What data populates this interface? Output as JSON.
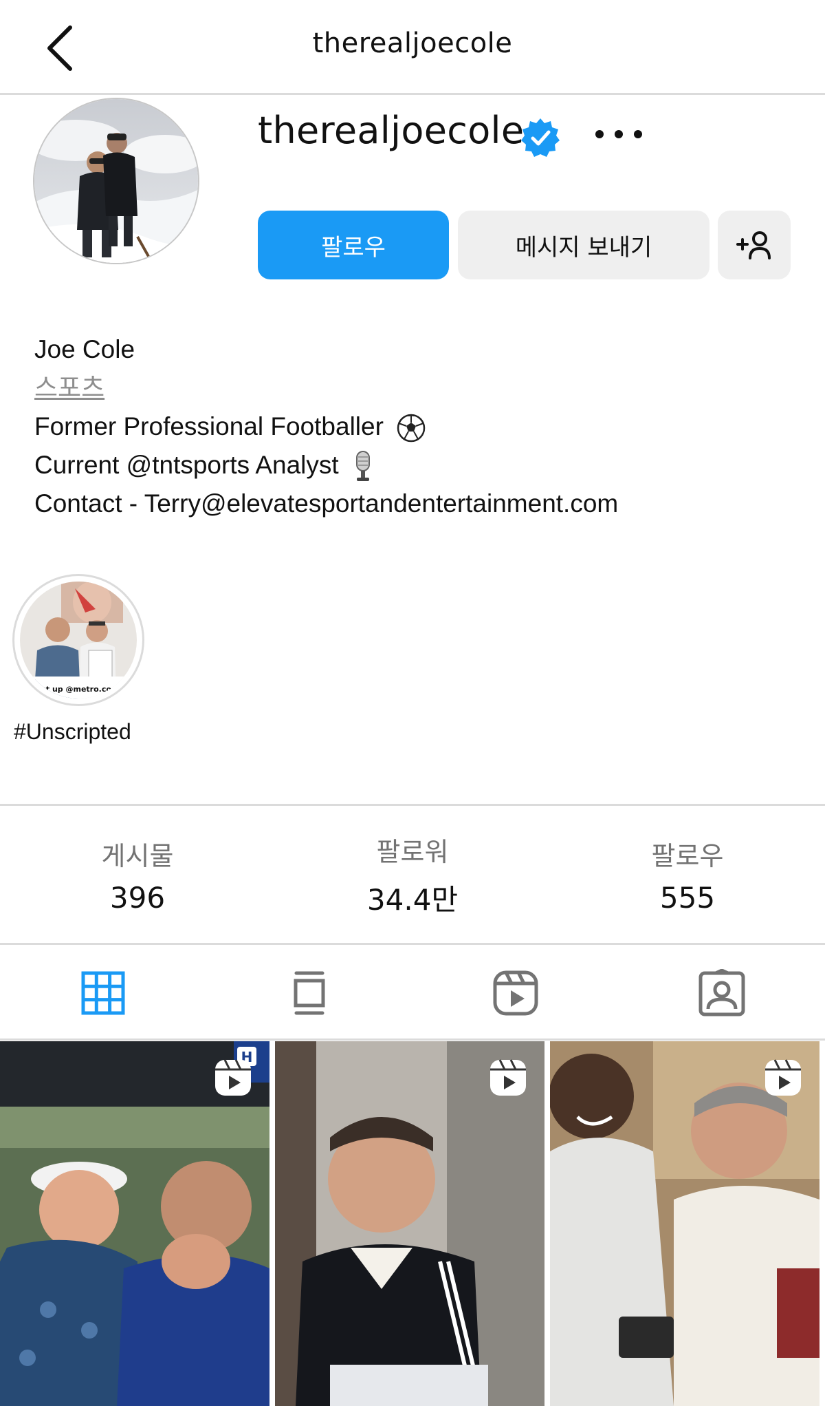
{
  "header": {
    "title": "therealjoecole",
    "back_icon": "chevron-left-icon"
  },
  "profile": {
    "username": "therealjoecole",
    "verified": true,
    "follow_label": "팔로우",
    "message_label": "메시지 보내기",
    "add_user_icon": "person-add-icon",
    "more_icon": "more-horizontal-icon"
  },
  "bio": {
    "name": "Joe Cole",
    "category": "스포츠",
    "line1": "Former Professional Footballer",
    "line2": "Current @tntsports Analyst",
    "line3": "Contact - Terry@elevatesportandentertainment.com",
    "line1_emoji": "soccer-ball-icon",
    "line2_emoji": "microphone-icon"
  },
  "highlight": {
    "label": "#Unscripted",
    "caption": "first up @metro.co.uk"
  },
  "stats": {
    "posts_label": "게시물",
    "posts_value": "396",
    "followers_label": "팔로워",
    "followers_value": "34.4만",
    "following_label": "팔로우",
    "following_value": "555"
  },
  "tabs": [
    {
      "name": "grid-tab",
      "icon": "grid-icon",
      "active": true
    },
    {
      "name": "feed-tab",
      "icon": "feed-icon",
      "active": false
    },
    {
      "name": "reels-tab",
      "icon": "reels-icon",
      "active": false
    },
    {
      "name": "tagged-tab",
      "icon": "tagged-icon",
      "active": false
    }
  ],
  "posts": [
    {
      "type": "reel",
      "icon": "reels-icon"
    },
    {
      "type": "reel",
      "icon": "reels-icon"
    },
    {
      "type": "reel",
      "icon": "reels-icon"
    }
  ],
  "colors": {
    "accent": "#1a9af5",
    "button_gray": "#efefef",
    "divider": "#dbdbdb",
    "secondary_text": "#737373",
    "active_tab": "#1a9af5"
  }
}
